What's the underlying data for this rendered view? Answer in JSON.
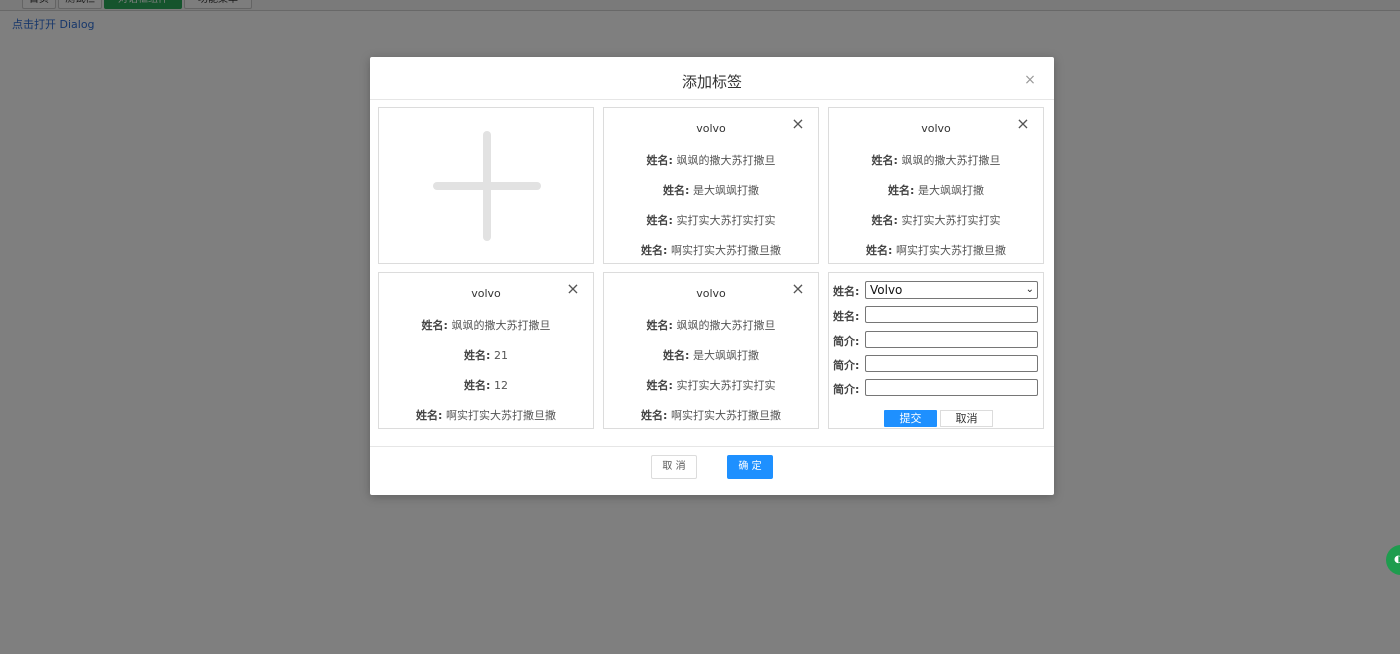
{
  "background": {
    "top_buttons": [
      "首页",
      "测试栏",
      "对话框组件",
      "功能菜单"
    ],
    "open_link": "点击打开 Dialog"
  },
  "dialog": {
    "title": "添加标签",
    "close_icon": "×",
    "cards": [
      {
        "title": "volvo",
        "rows": [
          {
            "label": "姓名:",
            "value": "飒飒的撒大苏打撒旦"
          },
          {
            "label": "姓名:",
            "value": "是大飒飒打撒"
          },
          {
            "label": "姓名:",
            "value": "实打实大苏打实打实"
          },
          {
            "label": "姓名:",
            "value": "啊实打实大苏打撒旦撒"
          }
        ]
      },
      {
        "title": "volvo",
        "rows": [
          {
            "label": "姓名:",
            "value": "飒飒的撒大苏打撒旦"
          },
          {
            "label": "姓名:",
            "value": "是大飒飒打撒"
          },
          {
            "label": "姓名:",
            "value": "实打实大苏打实打实"
          },
          {
            "label": "姓名:",
            "value": "啊实打实大苏打撒旦撒"
          }
        ]
      },
      {
        "title": "volvo",
        "rows": [
          {
            "label": "姓名:",
            "value": "飒飒的撒大苏打撒旦"
          },
          {
            "label": "姓名:",
            "value": "21"
          },
          {
            "label": "姓名:",
            "value": "12"
          },
          {
            "label": "姓名:",
            "value": "啊实打实大苏打撒旦撒"
          }
        ]
      },
      {
        "title": "volvo",
        "rows": [
          {
            "label": "姓名:",
            "value": "飒飒的撒大苏打撒旦"
          },
          {
            "label": "姓名:",
            "value": "是大飒飒打撒"
          },
          {
            "label": "姓名:",
            "value": "实打实大苏打实打实"
          },
          {
            "label": "姓名:",
            "value": "啊实打实大苏打撒旦撒"
          }
        ]
      }
    ],
    "form": {
      "select_label": "姓名:",
      "select_value": "Volvo",
      "fields": [
        {
          "label": "姓名:",
          "value": ""
        },
        {
          "label": "简介:",
          "value": ""
        },
        {
          "label": "简介:",
          "value": ""
        },
        {
          "label": "简介:",
          "value": ""
        }
      ],
      "submit_label": "提交",
      "cancel_label": "取消"
    },
    "footer": {
      "cancel_label": "取 消",
      "ok_label": "确 定"
    }
  },
  "colors": {
    "primary": "#1e90ff",
    "overlay": "rgba(0,0,0,0.5)",
    "accent_green": "#2aa85a"
  },
  "icons": {
    "add": "plus-icon",
    "close": "close-icon",
    "select_caret": "chevron-down-icon"
  }
}
